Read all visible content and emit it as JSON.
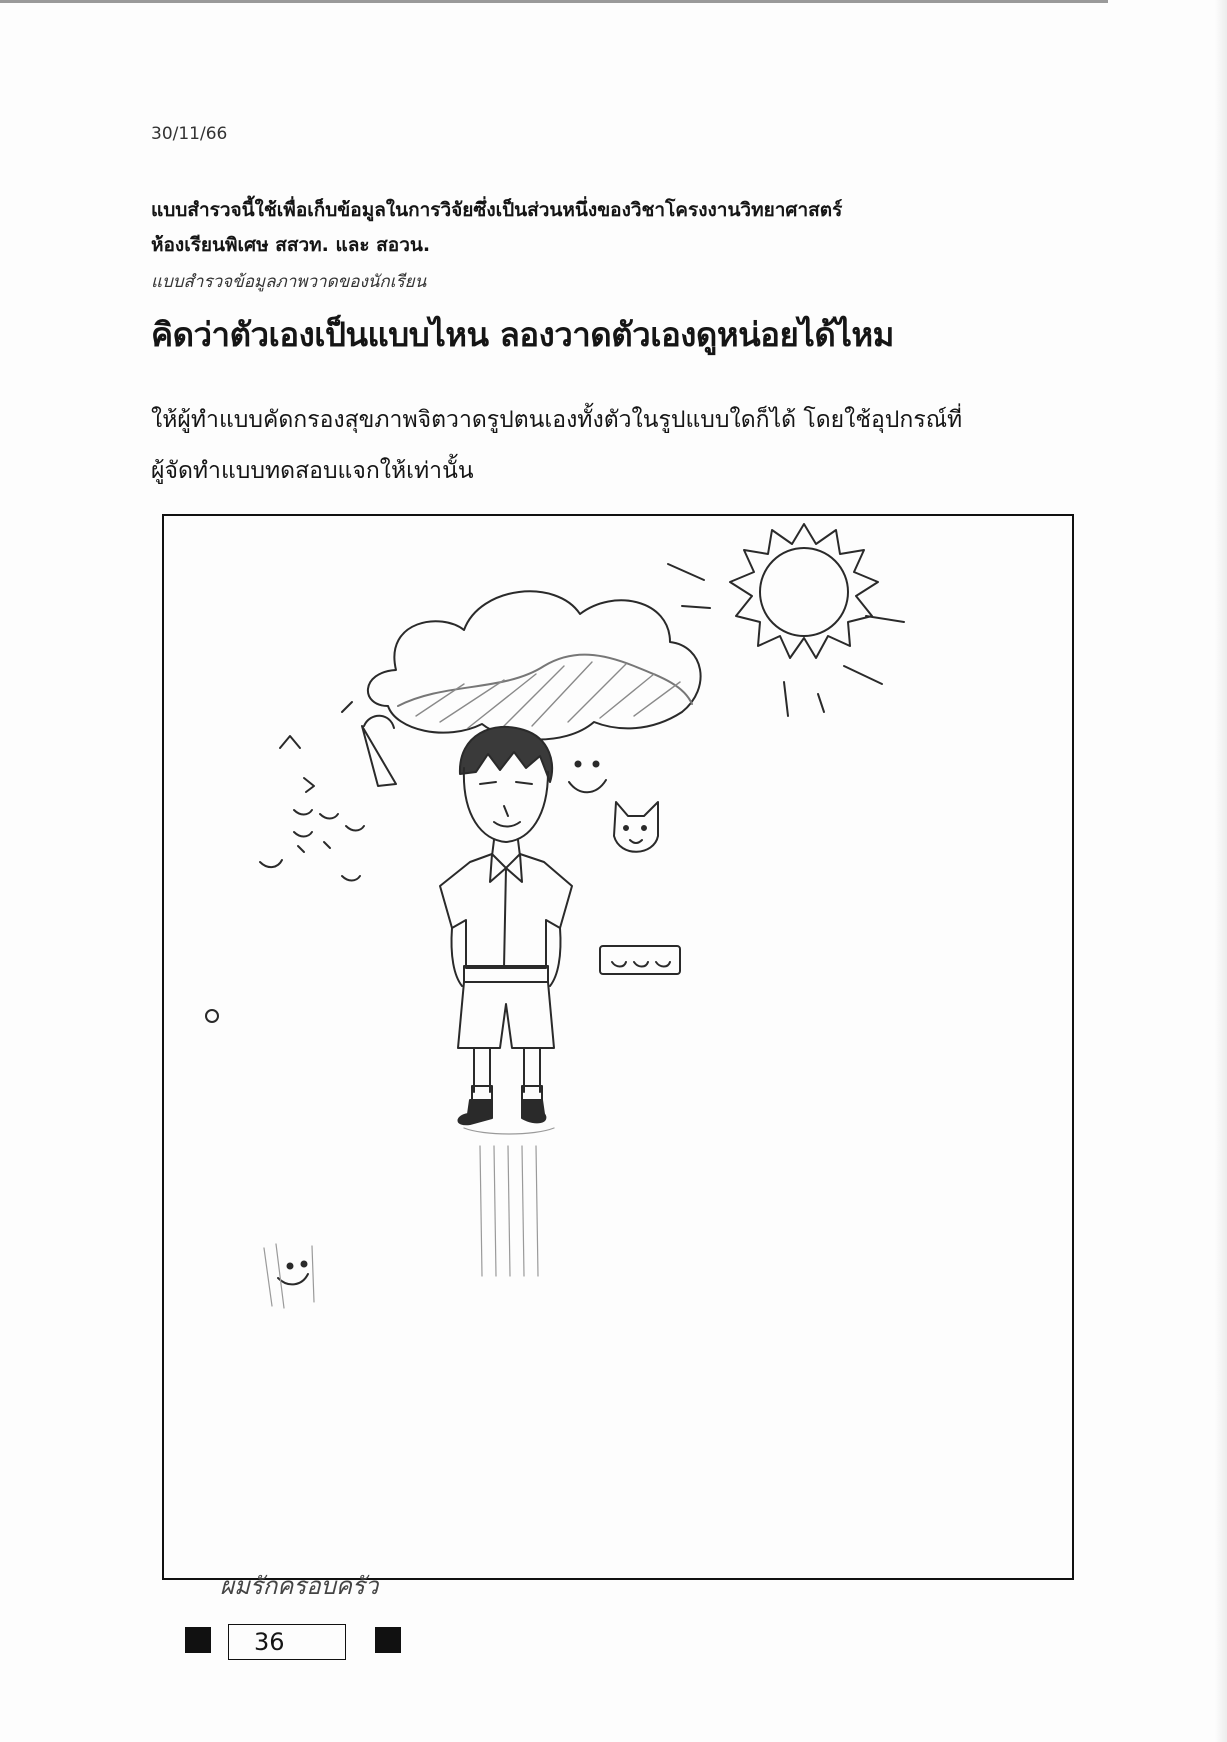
{
  "date": "30/11/66",
  "intro_lines": [
    "แบบสำรวจนี้ใช้เพื่อเก็บข้อมูลในการวิจัยซึ่งเป็นส่วนหนึ่งของวิชาโครงงานวิทยาศาสตร์",
    "ห้องเรียนพิเศษ สสวท. และ สอวน."
  ],
  "subtitle": "แบบสำรวจข้อมูลภาพวาดของนักเรียน",
  "title": "คิดว่าตัวเองเป็นแบบไหน ลองวาดตัวเองดูหน่อยได้ไหม",
  "instructions": [
    "ให้ผู้ทำแบบคัดกรองสุขภาพจิตวาดรูปตนเองทั้งตัวในรูปแบบใดก็ได้ โดยใช้อุปกรณ์ที่",
    "ผู้จัดทำแบบทดสอบแจกให้เท่านั้น"
  ],
  "drawing": {
    "handwritten_caption": "ผมรักครอบครัว",
    "elements": [
      "sun-icon",
      "cloud-icon",
      "boy-figure",
      "cat-face-icon",
      "smiley-box-icon",
      "falling-ice-cream-icon",
      "scattered-faces",
      "smiley-icon"
    ]
  },
  "page_number": "36"
}
